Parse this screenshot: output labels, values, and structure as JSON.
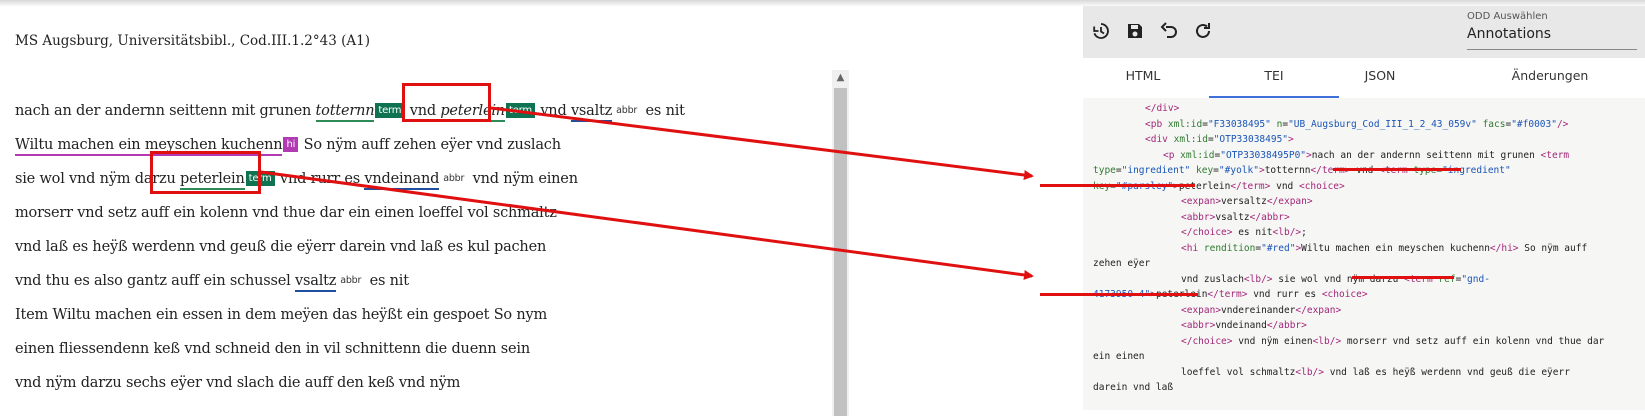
{
  "document": {
    "title": "MS Augsburg, Universitätsbibl., Cod.III.1.2°43 (A1)",
    "lines": [
      [
        {
          "t": "nach an der andernn seittenn mit grunen "
        },
        {
          "t": "totternn",
          "cls": "it ul-green"
        },
        {
          "badge": "term",
          "cls": "badge-term"
        },
        {
          "t": " vnd "
        },
        {
          "t": "peterlein",
          "cls": "it ul-green"
        },
        {
          "badge": "term",
          "cls": "badge-term"
        },
        {
          "t": " vnd "
        },
        {
          "t": "vsaltz",
          "cls": "ul-blue"
        },
        {
          "badge": "abbr",
          "cls": "badge-abbr"
        },
        {
          "t": " es nit"
        }
      ],
      [
        {
          "t": "Wiltu machen ein meyschen kuchenn",
          "cls": "ul-magenta"
        },
        {
          "badge": "hi",
          "cls": "badge-hi"
        },
        {
          "t": " So nÿm auff zehen eÿer vnd zuslach"
        }
      ],
      [
        {
          "t": "sie wol vnd nÿm darzu "
        },
        {
          "t": "peterlein",
          "cls": "ul-green"
        },
        {
          "badge": "term",
          "cls": "badge-term"
        },
        {
          "t": " vnd rurr es "
        },
        {
          "t": "vndeinand",
          "cls": "ul-blue"
        },
        {
          "badge": "abbr",
          "cls": "badge-abbr"
        },
        {
          "t": " vnd nÿm einen"
        }
      ],
      [
        {
          "t": "morserr vnd setz auff ein kolenn vnd thue dar ein einen loeffel vol schmaltz"
        }
      ],
      [
        {
          "t": "vnd laß es heÿß werdenn vnd geuß die eÿerr darein vnd laß es kul pachen"
        }
      ],
      [
        {
          "t": "vnd thu es also gantz auff ein schussel "
        },
        {
          "t": "vsaltz",
          "cls": "ul-blue"
        },
        {
          "badge": "abbr",
          "cls": "badge-abbr"
        },
        {
          "t": " es nit"
        }
      ],
      [
        {
          "t": "Item Wiltu machen ein essen in dem meÿen das heÿßt ein gespoet So nym"
        }
      ],
      [
        {
          "t": "einen fliessendenn keß vnd schneid den in vil schnittenn die duenn sein"
        }
      ],
      [
        {
          "t": "vnd nÿm darzu sechs eÿer vnd slach die auff den keß vnd nÿm"
        }
      ]
    ]
  },
  "toolbar": {
    "icons": [
      "history-icon",
      "save-icon",
      "undo-icon",
      "redo-icon"
    ],
    "odd_label": "ODD Auswählen",
    "odd_value": "Annotations"
  },
  "tabs": [
    {
      "label": "HTML",
      "active": false
    },
    {
      "label": "TEI",
      "active": true
    },
    {
      "label": "JSON",
      "active": false
    },
    {
      "label": "Änderungen",
      "active": false
    }
  ],
  "code_lines": [
    [
      {
        "c": "tag",
        "t": "</div>"
      }
    ],
    [
      {
        "c": "tag",
        "t": "<pb "
      },
      {
        "c": "attr",
        "t": "xml:id"
      },
      {
        "t": "="
      },
      {
        "c": "val",
        "t": "\"F33038495\""
      },
      {
        "t": " "
      },
      {
        "c": "attr",
        "t": "n"
      },
      {
        "t": "="
      },
      {
        "c": "val",
        "t": "\"UB_Augsburg_Cod_III_1_2_43_059v\""
      },
      {
        "t": " "
      },
      {
        "c": "attr",
        "t": "facs"
      },
      {
        "t": "="
      },
      {
        "c": "val",
        "t": "\"#f0003\""
      },
      {
        "c": "tag",
        "t": "/>"
      }
    ],
    [
      {
        "c": "tag",
        "t": "<div "
      },
      {
        "c": "attr",
        "t": "xml:id"
      },
      {
        "t": "="
      },
      {
        "c": "val",
        "t": "\"OTP33038495\""
      },
      {
        "c": "tag",
        "t": ">"
      }
    ],
    [
      {
        "c": "tag",
        "t": "<p "
      },
      {
        "c": "attr",
        "t": "xml:id"
      },
      {
        "t": "="
      },
      {
        "c": "val",
        "t": "\"OTP33038495P0\""
      },
      {
        "c": "tag",
        "t": ">"
      },
      {
        "t": "nach an der andernn seittenn mit grunen "
      },
      {
        "c": "tag",
        "t": "<term"
      }
    ],
    [
      {
        "c": "attr",
        "t": "type"
      },
      {
        "t": "="
      },
      {
        "c": "val",
        "t": "\"ingredient\""
      },
      {
        "t": " "
      },
      {
        "c": "attr",
        "t": "key"
      },
      {
        "t": "="
      },
      {
        "c": "val",
        "t": "\"#yolk\""
      },
      {
        "c": "tag",
        "t": ">"
      },
      {
        "t": "totternn"
      },
      {
        "c": "tag",
        "t": "</term>"
      },
      {
        "t": " vnd "
      },
      {
        "c": "tag",
        "t": "<term "
      },
      {
        "c": "attr",
        "t": "type"
      },
      {
        "t": "="
      },
      {
        "c": "val",
        "t": "\"ingredient\""
      }
    ],
    [
      {
        "c": "attr",
        "t": "key"
      },
      {
        "t": "="
      },
      {
        "c": "val",
        "t": "\"#parsley\""
      },
      {
        "c": "tag",
        "t": ">"
      },
      {
        "t": "peterlein"
      },
      {
        "c": "tag",
        "t": "</term>"
      },
      {
        "t": " vnd "
      },
      {
        "c": "tag",
        "t": "<choice>"
      }
    ],
    [
      {
        "c": "tag",
        "t": "<expan>"
      },
      {
        "t": "versaltz"
      },
      {
        "c": "tag",
        "t": "</expan>"
      }
    ],
    [
      {
        "c": "tag",
        "t": "<abbr>"
      },
      {
        "t": "vsaltz"
      },
      {
        "c": "tag",
        "t": "</abbr>"
      }
    ],
    [
      {
        "c": "tag",
        "t": "</choice>"
      },
      {
        "t": " es nit"
      },
      {
        "c": "tag",
        "t": "<lb/>"
      },
      {
        "t": ";"
      }
    ],
    [
      {
        "c": "tag",
        "t": "<hi "
      },
      {
        "c": "attr",
        "t": "rendition"
      },
      {
        "t": "="
      },
      {
        "c": "val",
        "t": "\"#red\""
      },
      {
        "c": "tag",
        "t": ">"
      },
      {
        "t": "Wiltu machen ein meyschen kuchenn"
      },
      {
        "c": "tag",
        "t": "</hi>"
      },
      {
        "t": " So nÿm auff"
      }
    ],
    [
      {
        "t": "zehen eÿer"
      }
    ],
    [
      {
        "t": "vnd zuslach"
      },
      {
        "c": "tag",
        "t": "<lb/>"
      },
      {
        "t": " sie wol vnd nÿm darzu "
      },
      {
        "c": "tag",
        "t": "<term "
      },
      {
        "c": "attr",
        "t": "ref"
      },
      {
        "t": "="
      },
      {
        "c": "val",
        "t": "\"gnd-"
      }
    ],
    [
      {
        "c": "val",
        "t": "4173950-4\""
      },
      {
        "c": "tag",
        "t": ">"
      },
      {
        "t": "peterlein"
      },
      {
        "c": "tag",
        "t": "</term>"
      },
      {
        "t": " vnd rurr es "
      },
      {
        "c": "tag",
        "t": "<choice>"
      }
    ],
    [
      {
        "c": "tag",
        "t": "<expan>"
      },
      {
        "t": "vndereinander"
      },
      {
        "c": "tag",
        "t": "</expan>"
      }
    ],
    [
      {
        "c": "tag",
        "t": "<abbr>"
      },
      {
        "t": "vndeinand"
      },
      {
        "c": "tag",
        "t": "</abbr>"
      }
    ],
    [
      {
        "c": "tag",
        "t": "</choice>"
      },
      {
        "t": " vnd nÿm einen"
      },
      {
        "c": "tag",
        "t": "<lb/>"
      },
      {
        "t": " morserr vnd setz auff ein kolenn vnd thue dar"
      }
    ],
    [
      {
        "t": "ein einen"
      }
    ],
    [
      {
        "t": "loeffel vol schmaltz"
      },
      {
        "c": "tag",
        "t": "<lb/>"
      },
      {
        "t": " vnd laß es heÿß werdenn vnd geuß die eÿerr"
      }
    ],
    [
      {
        "t": "darein vnd laß"
      }
    ]
  ]
}
